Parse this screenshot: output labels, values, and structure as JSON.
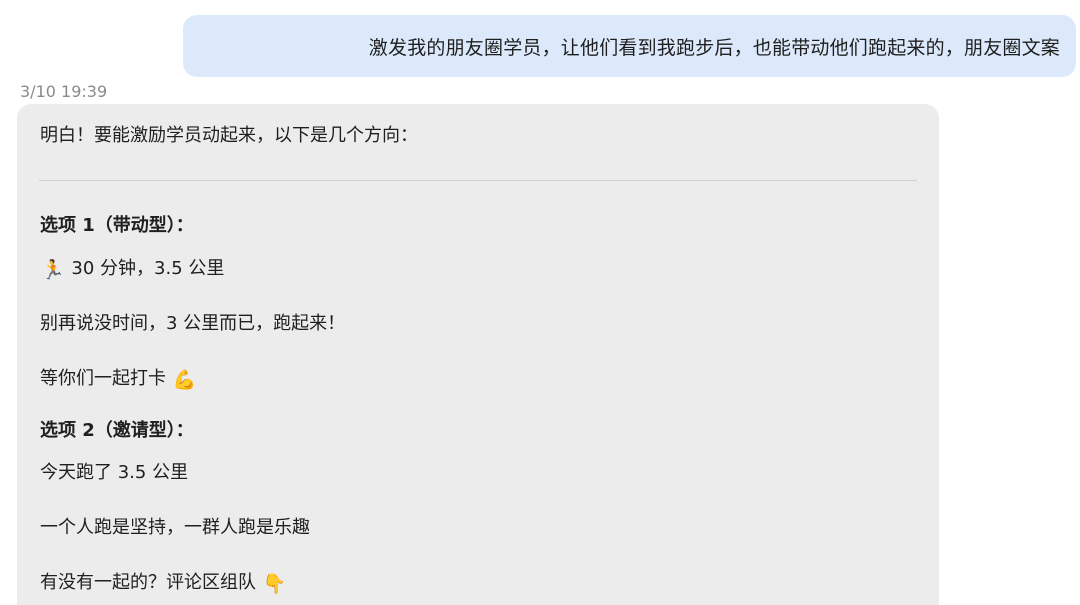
{
  "user_message": {
    "text": "激发我的朋友圈学员，让他们看到我跑步后，也能带动他们跑起来的，朋友圈文案"
  },
  "timestamp": "3/10 19:39",
  "reply": {
    "intro": "明白！要能激励学员动起来，以下是几个方向：",
    "options": [
      {
        "heading": "选项 1（带动型）：",
        "lines": [
          {
            "emoji": "🏃",
            "emoji_name": "runner-icon",
            "text": "30 分钟，3.5 公里"
          },
          {
            "text": "别再说没时间，3 公里而已，跑起来！"
          },
          {
            "text": "等你们一起打卡",
            "emoji": "💪",
            "emoji_name": "flexed-biceps-icon"
          }
        ]
      },
      {
        "heading": "选项 2（邀请型）：",
        "lines": [
          {
            "text": "今天跑了 3.5 公里"
          },
          {
            "text": "一个人跑是坚持，一群人跑是乐趣"
          },
          {
            "text": "有没有一起的？评论区组队",
            "emoji": "👇",
            "emoji_name": "pointing-down-icon"
          }
        ]
      }
    ]
  }
}
